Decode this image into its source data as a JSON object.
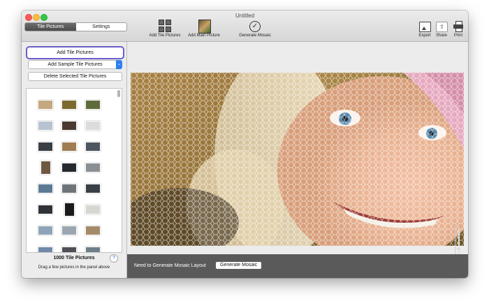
{
  "window": {
    "title": "Untitled"
  },
  "segmented": {
    "tabs": [
      "Tile Pictures",
      "Settings"
    ]
  },
  "toolbar": {
    "add_tile_pictures": "Add Tile Pictures",
    "add_main_picture": "Add Main Picture",
    "generate_mosaic": "Generate Mosaic",
    "export": "Export",
    "share": "Share",
    "print": "Print"
  },
  "sidebar": {
    "add_tile_button": "Add Tile Pictures",
    "add_sample_select": "Add Sample Tile Pictures",
    "delete_button": "Delete Selected Tile Pictures",
    "tile_count": "1000 Tile Pictures",
    "help": "?",
    "drag_hint": "Drag a few pictures in the panel above"
  },
  "tiles": [
    {
      "color": "#c5a87f",
      "icon": "photo-thumbnail"
    },
    {
      "color": "#7d6a2e",
      "icon": "photo-thumbnail"
    },
    {
      "color": "#5e6b3a",
      "icon": "photo-thumbnail"
    },
    {
      "color": "#b8c2d0",
      "icon": "photo-thumbnail"
    },
    {
      "color": "#4a3a30",
      "icon": "photo-thumbnail"
    },
    {
      "color": "#dcdcdc",
      "icon": "photo-thumbnail"
    },
    {
      "color": "#3a3f45",
      "icon": "photo-thumbnail"
    },
    {
      "color": "#a07c52",
      "icon": "photo-thumbnail"
    },
    {
      "color": "#4d5560",
      "icon": "photo-thumbnail"
    },
    {
      "color": "#6e5842",
      "icon": "photo-thumbnail",
      "tall": true
    },
    {
      "color": "#26292e",
      "icon": "photo-thumbnail"
    },
    {
      "color": "#8a8f93",
      "icon": "photo-thumbnail"
    },
    {
      "color": "#5d7a94",
      "icon": "photo-thumbnail"
    },
    {
      "color": "#707478",
      "icon": "photo-thumbnail"
    },
    {
      "color": "#3b4047",
      "icon": "photo-thumbnail"
    },
    {
      "color": "#2f3236",
      "icon": "photo-thumbnail"
    },
    {
      "color": "#1b1b1b",
      "icon": "photo-thumbnail",
      "tall": true
    },
    {
      "color": "#d8d6d0",
      "icon": "photo-thumbnail"
    },
    {
      "color": "#8fa4b8",
      "icon": "photo-thumbnail"
    },
    {
      "color": "#9ca6b0",
      "icon": "photo-thumbnail"
    },
    {
      "color": "#a58a6a",
      "icon": "photo-thumbnail"
    },
    {
      "color": "#6f8aa8",
      "icon": "photo-thumbnail"
    },
    {
      "color": "#4f4f58",
      "icon": "photo-thumbnail"
    },
    {
      "color": "#6e7d8a",
      "icon": "photo-thumbnail"
    }
  ],
  "status": {
    "message": "Need to Generate Mosaic Layout",
    "generate_button": "Generate Mosaic"
  },
  "colors": {
    "focus_ring": "#6a5ecc",
    "select_accent": "#2e7ff2",
    "status_bar": "#5a5a5a"
  }
}
